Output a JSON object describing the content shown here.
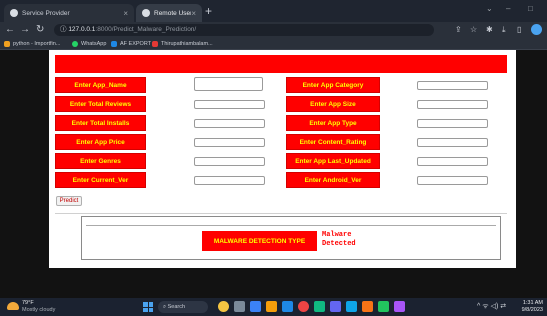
{
  "browser": {
    "tabs": [
      {
        "title": "Service Provider",
        "active": false
      },
      {
        "title": "Remote User",
        "active": true
      }
    ],
    "new_tab": "+",
    "window_controls": {
      "minimize": "⌄",
      "maximize": "–",
      "restore": "□"
    },
    "url_host": "127.0.0.1",
    "url_rest": ":8000/Predict_Malware_Prediction/",
    "bookmarks": [
      {
        "label": "python - Importfin...",
        "color": "#f0a020"
      },
      {
        "label": "WhatsApp",
        "color": "#25d366"
      },
      {
        "label": "AF EXPORT",
        "color": "#1e88e5"
      },
      {
        "label": "Thirupathiambalam...",
        "color": "#e53935"
      }
    ]
  },
  "form": {
    "left_labels": [
      "Enter App_Name",
      "Enter Total Reviews",
      "Enter Total Installs",
      "Enter App Price",
      "Enter Genres",
      "Enter Current_Ver"
    ],
    "right_labels": [
      "Enter App Category",
      "Enter App Size",
      "Enter App Type",
      "Enter Content_Rating",
      "Enter App Last_Updated",
      "Enter Android_Ver"
    ],
    "submit_label": "Predict"
  },
  "result": {
    "label": "MALWARE DETECTION TYPE",
    "value": "Malware\nDetected"
  },
  "taskbar": {
    "weather_temp": "79°F",
    "weather_desc": "Mostly cloudy",
    "search_placeholder": "Search",
    "tray": "^ ᯤ ◁) ⇄",
    "time": "1:31 AM",
    "date": "9/8/2023",
    "app_colors": [
      "#f5c542",
      "#7b8a9a",
      "#3b82f6",
      "#f59e0b",
      "#1e88e5",
      "#ef4444",
      "#10b981",
      "#6366f1",
      "#0ea5e9",
      "#f97316",
      "#22c55e",
      "#a855f7"
    ]
  },
  "colors": {
    "accent_red": "#ff0000",
    "label_text": "#ffff00"
  }
}
